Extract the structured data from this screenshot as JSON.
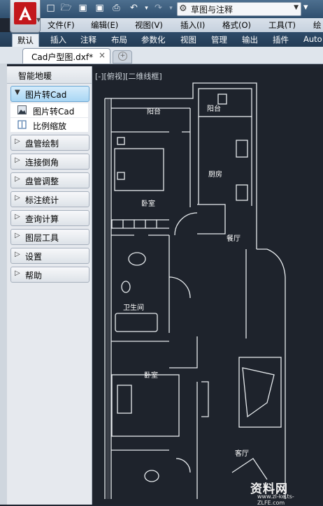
{
  "title_bar": {
    "workspace_value": "草图与注释"
  },
  "menu": {
    "items": [
      "文件(F)",
      "编辑(E)",
      "视图(V)",
      "插入(I)",
      "格式(O)",
      "工具(T)",
      "绘"
    ]
  },
  "ribbon": {
    "tabs": [
      "默认",
      "插入",
      "注释",
      "布局",
      "参数化",
      "视图",
      "管理",
      "输出",
      "插件",
      "Auto"
    ],
    "active_tab": "默认"
  },
  "document": {
    "tab_name": "Cad户型图.dxf*",
    "close_symbol": "×"
  },
  "sidebar": {
    "title": "智能地暖",
    "panels": [
      {
        "label": "图片转Cad",
        "open": true,
        "items": [
          "图片转Cad",
          "比例缩放"
        ]
      },
      {
        "label": "盘管绘制"
      },
      {
        "label": "连接倒角"
      },
      {
        "label": "盘管调整"
      },
      {
        "label": "标注统计"
      },
      {
        "label": "查询计算"
      },
      {
        "label": "图层工具"
      },
      {
        "label": "设置"
      },
      {
        "label": "帮助"
      }
    ]
  },
  "drawing": {
    "view_label": "[-][俯视][二维线框]",
    "rooms": [
      "阳台",
      "阳台",
      "卧室",
      "厨房",
      "餐厅",
      "卫生间",
      "卧室",
      "客厅"
    ]
  },
  "watermark": {
    "text": "资料网",
    "url": "www.zl-ke.ts-ZLFE.com"
  },
  "colors": {
    "drawing_bg": "#1e232c",
    "app_red": "#c3171b",
    "panel_open": "#a9d6f4"
  }
}
